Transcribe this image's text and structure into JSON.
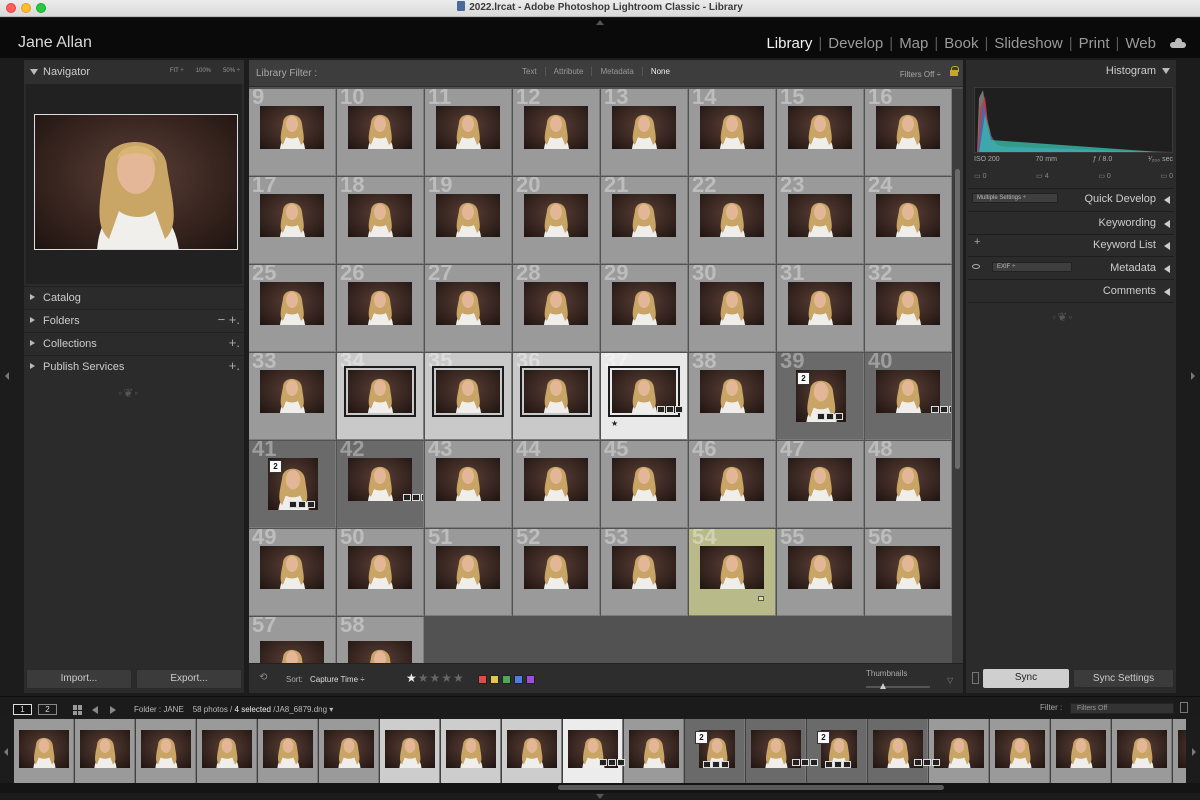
{
  "window": {
    "title": "2022.lrcat - Adobe Photoshop Lightroom Classic - Library"
  },
  "identity_plate": "Jane Allan",
  "modules": [
    {
      "label": "Library",
      "active": true
    },
    {
      "label": "Develop",
      "active": false
    },
    {
      "label": "Map",
      "active": false
    },
    {
      "label": "Book",
      "active": false
    },
    {
      "label": "Slideshow",
      "active": false
    },
    {
      "label": "Print",
      "active": false
    },
    {
      "label": "Web",
      "active": false
    }
  ],
  "left_panel": {
    "navigator": {
      "title": "Navigator",
      "zooms": [
        "FIT ÷",
        "100%",
        "50% ÷"
      ]
    },
    "sections": [
      {
        "label": "Catalog",
        "actions": ""
      },
      {
        "label": "Folders",
        "actions": "− +."
      },
      {
        "label": "Collections",
        "actions": "+."
      },
      {
        "label": "Publish Services",
        "actions": "+."
      }
    ],
    "import_label": "Import...",
    "export_label": "Export..."
  },
  "library_filter": {
    "label": "Library Filter :",
    "tabs": [
      {
        "label": "Text",
        "on": false
      },
      {
        "label": "Attribute",
        "on": false
      },
      {
        "label": "Metadata",
        "on": false
      },
      {
        "label": "None",
        "on": true
      }
    ],
    "filters_off": "Filters Off ÷"
  },
  "grid": {
    "cells": [
      {
        "n": "9"
      },
      {
        "n": "10"
      },
      {
        "n": "11"
      },
      {
        "n": "12"
      },
      {
        "n": "13"
      },
      {
        "n": "14"
      },
      {
        "n": "15"
      },
      {
        "n": "16"
      },
      {
        "n": "17"
      },
      {
        "n": "18"
      },
      {
        "n": "19"
      },
      {
        "n": "20"
      },
      {
        "n": "21"
      },
      {
        "n": "22"
      },
      {
        "n": "23"
      },
      {
        "n": "24"
      },
      {
        "n": "25"
      },
      {
        "n": "26"
      },
      {
        "n": "27"
      },
      {
        "n": "28"
      },
      {
        "n": "29"
      },
      {
        "n": "30"
      },
      {
        "n": "31"
      },
      {
        "n": "32"
      },
      {
        "n": "33"
      },
      {
        "n": "34",
        "state": "sel"
      },
      {
        "n": "35",
        "state": "sel"
      },
      {
        "n": "36",
        "state": "sel"
      },
      {
        "n": "37",
        "state": "primary",
        "star": "★"
      },
      {
        "n": "38"
      },
      {
        "n": "39",
        "state": "stackbg",
        "stack": "2"
      },
      {
        "n": "40",
        "state": "stackbg"
      },
      {
        "n": "41",
        "state": "stackbg",
        "stack": "2"
      },
      {
        "n": "42",
        "state": "stackbg"
      },
      {
        "n": "43"
      },
      {
        "n": "44"
      },
      {
        "n": "45"
      },
      {
        "n": "46"
      },
      {
        "n": "47"
      },
      {
        "n": "48"
      },
      {
        "n": "49"
      },
      {
        "n": "50"
      },
      {
        "n": "51"
      },
      {
        "n": "52"
      },
      {
        "n": "53"
      },
      {
        "n": "54",
        "state": "label-yellow"
      },
      {
        "n": "55"
      },
      {
        "n": "56"
      },
      {
        "n": "57"
      },
      {
        "n": "58"
      }
    ]
  },
  "toolbar": {
    "sort_label": "Sort:",
    "sort_value": "Capture Time ÷",
    "stars": "★★★★★",
    "colors": [
      "#d94f4f",
      "#d9c94f",
      "#4faa4f",
      "#4f7fd9",
      "#9a4fd9"
    ],
    "thumbnails_label": "Thumbnails"
  },
  "right_panel": {
    "histogram_title": "Histogram",
    "exif": {
      "iso": "ISO 200",
      "focal": "70 mm",
      "aperture": "ƒ / 8.0",
      "shutter": "¹⁄₂₀₀ sec"
    },
    "clip_values": [
      "0",
      "4",
      "0",
      "0"
    ],
    "quick_develop": {
      "preset": "Multiple Settings ÷",
      "label": "Quick Develop"
    },
    "keywording": "Keywording",
    "keyword_list": "Keyword List",
    "metadata": {
      "preset": "EXIF ÷",
      "label": "Metadata"
    },
    "comments": "Comments",
    "sync_label": "Sync",
    "sync_settings_label": "Sync Settings"
  },
  "filmstrip_bar": {
    "monitor1": "1",
    "monitor2": "2",
    "folder_text": "Folder : JANE",
    "count_text": "58 photos /",
    "selected_text": "4 selected",
    "file_text": "/JA8_6879.dng ▾",
    "filter_label": "Filter :",
    "filter_value": "Filters Off"
  },
  "filmstrip": {
    "cells": [
      {
        "state": ""
      },
      {
        "state": ""
      },
      {
        "state": ""
      },
      {
        "state": ""
      },
      {
        "state": ""
      },
      {
        "state": ""
      },
      {
        "state": "sel"
      },
      {
        "state": "sel"
      },
      {
        "state": "sel"
      },
      {
        "state": "primary"
      },
      {
        "state": ""
      },
      {
        "state": "stackbg",
        "stack": "2"
      },
      {
        "state": "stackbg"
      },
      {
        "state": "stackbg",
        "stack": "2"
      },
      {
        "state": "stackbg"
      },
      {
        "state": ""
      },
      {
        "state": ""
      },
      {
        "state": ""
      },
      {
        "state": ""
      },
      {
        "state": ""
      }
    ]
  }
}
